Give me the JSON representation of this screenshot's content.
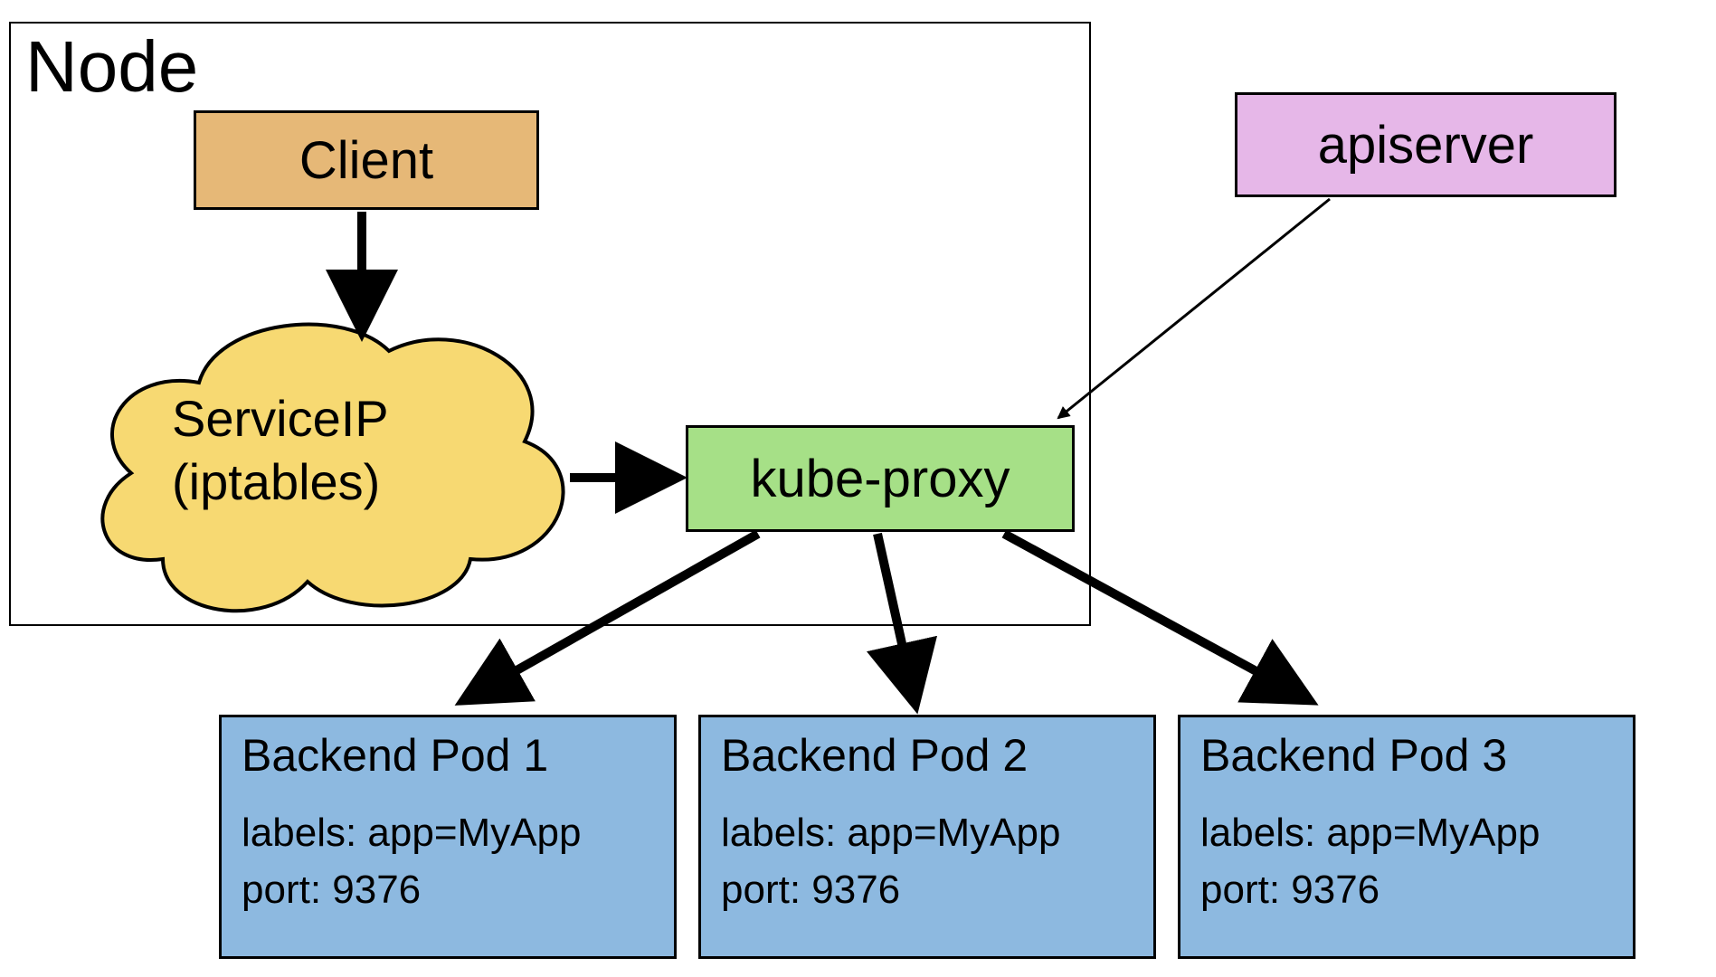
{
  "node_label": "Node",
  "client_label": "Client",
  "apiserver_label": "apiserver",
  "cloud_line1": "ServiceIP",
  "cloud_line2": "(iptables)",
  "proxy_label": "kube-proxy",
  "pods": [
    {
      "title": "Backend Pod 1",
      "labels": "labels: app=MyApp",
      "port": "port: 9376"
    },
    {
      "title": "Backend Pod 2",
      "labels": "labels: app=MyApp",
      "port": "port: 9376"
    },
    {
      "title": "Backend Pod 3",
      "labels": "labels: app=MyApp",
      "port": "port: 9376"
    }
  ],
  "colors": {
    "client": "#e6b877",
    "apiserver": "#e6b7e8",
    "proxy": "#a6e087",
    "cloud": "#f7d972",
    "pod": "#8db9e0"
  }
}
